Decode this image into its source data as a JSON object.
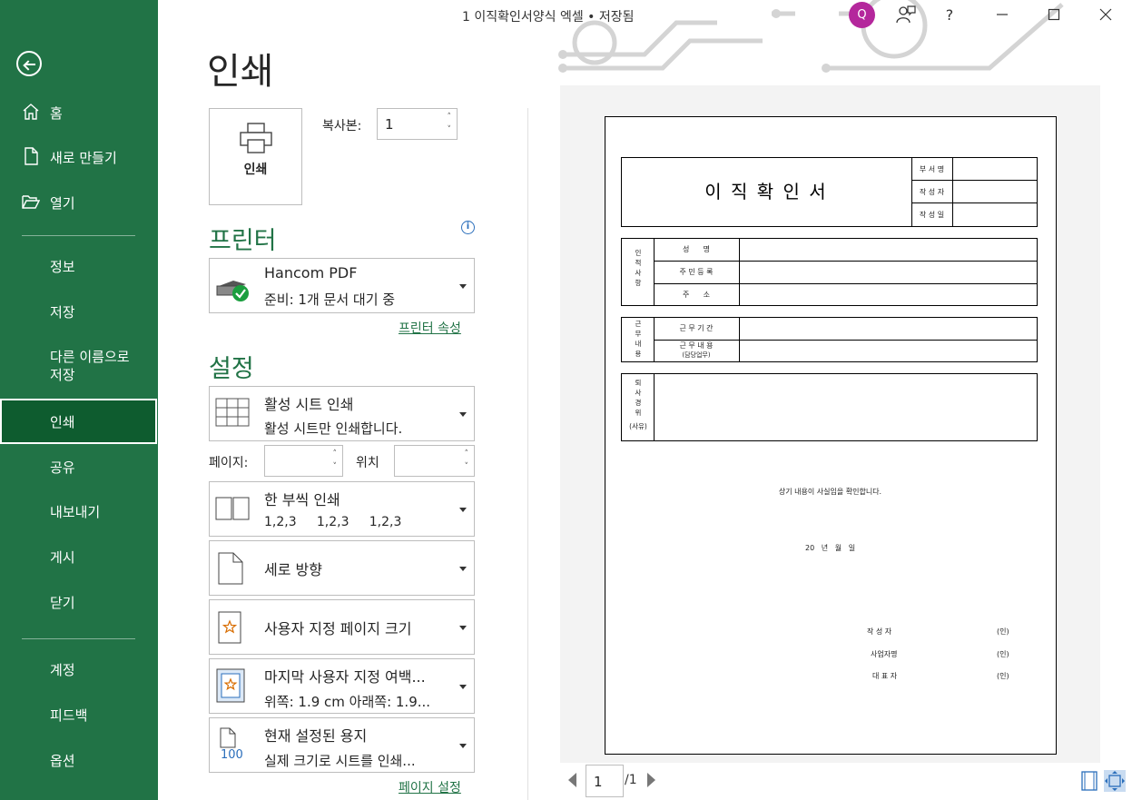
{
  "window": {
    "title": "1 이직확인서양식 엑셀 • 저장됨",
    "avatar_letter": "Q",
    "help_label": "?"
  },
  "sidebar": {
    "back_icon": "back-arrow-icon",
    "items": [
      {
        "label": "홈",
        "icon": "home-icon"
      },
      {
        "label": "새로 만들기",
        "icon": "new-file-icon"
      },
      {
        "label": "열기",
        "icon": "folder-open-icon"
      },
      {
        "label": "정보"
      },
      {
        "label": "저장"
      },
      {
        "label": "다른 이름으로 저장",
        "line1": "다른 이름으로",
        "line2": "저장"
      },
      {
        "label": "인쇄",
        "active": true
      },
      {
        "label": "공유"
      },
      {
        "label": "내보내기"
      },
      {
        "label": "게시"
      },
      {
        "label": "닫기"
      },
      {
        "label": "계정"
      },
      {
        "label": "피드백"
      },
      {
        "label": "옵션"
      }
    ],
    "colors": {
      "background": "#217346",
      "active": "#0e5c2f"
    }
  },
  "print": {
    "heading": "인쇄",
    "button_label": "인쇄",
    "copies_label": "복사본:",
    "copies_value": "1",
    "printer_heading": "프린터",
    "printer_name": "Hancom PDF",
    "printer_status": "준비: 1개 문서 대기 중",
    "printer_props_link": "프린터 속성",
    "settings_heading": "설정",
    "scope_title": "활성 시트 인쇄",
    "scope_desc": "활성 시트만 인쇄합니다.",
    "pages_label": "페이지:",
    "pages_from": "",
    "pages_to_label": "위치",
    "pages_to": "",
    "collate_title": "한 부씩 인쇄",
    "collate_desc": "1,2,3     1,2,3     1,2,3",
    "orientation": "세로 방향",
    "paper_size": "사용자 지정 페이지 크기",
    "margins_title": "마지막 사용자 지정 여백...",
    "margins_desc": "위쪽: 1.9 cm 아래쪽: 1.9...",
    "scaling_title": "현재 설정된 용지",
    "scaling_desc": "실제 크기로 시트를 인쇄...",
    "scaling_badge": "100",
    "page_setup_link": "페이지 설정",
    "accent": "#217346"
  },
  "preview": {
    "doc_title": "이 직 확 인 서",
    "approval": [
      "부 서 명",
      "작 성 자",
      "작 성 일"
    ],
    "personal_section": "인적사항",
    "personal_rows": [
      "성      명",
      "주 민 등 록",
      "주      소"
    ],
    "work_section": "근무내용",
    "work_rows": [
      "근 무 기 간",
      "근 무 내 용",
      "(담당업무)"
    ],
    "reason_section": "퇴사경위",
    "reason_sub": "(사유)",
    "confirm_text": "상기 내용이 사실임을 확인합니다.",
    "date_text": "20   년   월   일",
    "sign_rows": [
      {
        "label": "작 성 자",
        "mark": "(인)"
      },
      {
        "label": "사업자명",
        "mark": "(인)"
      },
      {
        "label": "대 표 자",
        "mark": "(인)"
      }
    ],
    "current_page": "1",
    "total_pages": "/1"
  }
}
